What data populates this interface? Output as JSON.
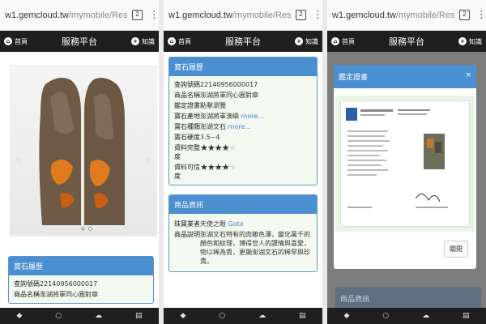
{
  "browser": {
    "host": "w1.gemcloud.tw",
    "path": "/mymobile/Res",
    "tab_count": "2"
  },
  "nav": {
    "home_label": "首頁",
    "title": "服務平台",
    "right_label": "知識",
    "home_icon": "home-icon",
    "right_icon": "plus-icon"
  },
  "gemstone_panel": {
    "title": "寶石履歷",
    "rows": [
      {
        "key": "查詢號碼",
        "value": "22140956000017"
      },
      {
        "key": "商品名稱",
        "value": "澎湖將軍同心圓對章"
      },
      {
        "key": "鑑定證書",
        "value": "點擊瀏覽"
      },
      {
        "key": "寶石產地",
        "value": "澎湖將軍澳嶼",
        "more": "more..."
      },
      {
        "key": "寶石種類",
        "value": "澎湖文石",
        "more": "more..."
      },
      {
        "key": "寶石硬度",
        "value": "3.5~4"
      },
      {
        "key": "資料完整度",
        "stars": 4
      },
      {
        "key": "資料可信度",
        "stars": 4
      }
    ]
  },
  "product_panel": {
    "title": "商品資訊",
    "seller_key": "珠寶業者",
    "seller_value": "天使之眼",
    "seller_link": "Goto",
    "desc_key": "商品說明",
    "desc_value": "澎湖文石特有的肉雜色澤，變化萬千的顏色和紋理，博得世人的讚情與喜愛，物以稀為貴，更顯澎湖文石的稀罕與珍貴。"
  },
  "cert_modal": {
    "title": "鑑定證書",
    "close_glyph": "×",
    "close_button": "關閉"
  },
  "page3_peek": {
    "label": "商品資訊"
  },
  "bottom_bar": {
    "icons": [
      "diamond-icon",
      "ring-icon",
      "cloud-icon",
      "cart-icon"
    ]
  },
  "colors": {
    "accent": "#4a8fcf",
    "nav": "#1f1f1f",
    "star": "#f3c21f",
    "panel_bg": "#f3f9ee"
  }
}
